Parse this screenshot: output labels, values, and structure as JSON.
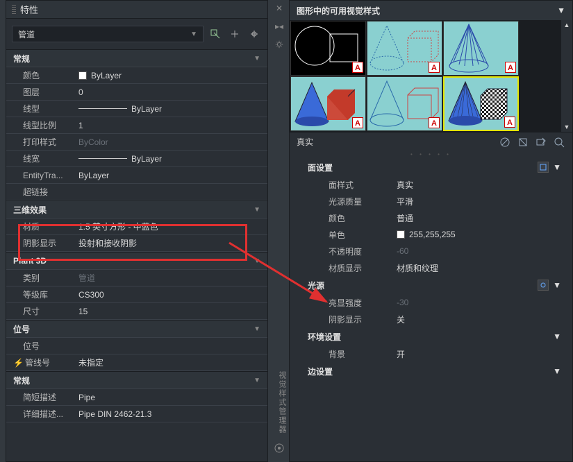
{
  "left": {
    "title": "特性",
    "selector": {
      "value": "管道"
    },
    "sections": {
      "general": {
        "title": "常规",
        "rows": {
          "color": {
            "label": "颜色",
            "value": "ByLayer"
          },
          "layer": {
            "label": "图层",
            "value": "0"
          },
          "linetype": {
            "label": "线型",
            "value": "ByLayer"
          },
          "ltscale": {
            "label": "线型比例",
            "value": "1"
          },
          "plotstyle": {
            "label": "打印样式",
            "value": "ByColor"
          },
          "lineweight": {
            "label": "线宽",
            "value": "ByLayer"
          },
          "transparency": {
            "label": "EntityTra...",
            "value": "ByLayer"
          },
          "hyperlink": {
            "label": "超链接",
            "value": ""
          }
        }
      },
      "threed": {
        "title": "三维效果",
        "rows": {
          "material": {
            "label": "材质",
            "value": "1.5 英寸方形 - 中蓝色"
          },
          "shadow": {
            "label": "阴影显示",
            "value": "投射和接收阴影"
          }
        }
      },
      "plant3d": {
        "title": "Plant 3D",
        "rows": {
          "category": {
            "label": "类别",
            "value": "管道"
          },
          "spec": {
            "label": "等级库",
            "value": "CS300"
          },
          "size": {
            "label": "尺寸",
            "value": "15"
          }
        }
      },
      "tag": {
        "title": "位号",
        "rows": {
          "tagno": {
            "label": "位号",
            "value": ""
          },
          "lineNo": {
            "label": "管线号",
            "value": "未指定"
          }
        }
      },
      "general2": {
        "title": "常规",
        "rows": {
          "sdesc": {
            "label": "简短描述",
            "value": "Pipe"
          },
          "ldesc": {
            "label": "详细描述...",
            "value": "Pipe DIN 2462-21.3"
          }
        }
      }
    }
  },
  "right": {
    "headerTitle": "图形中的可用视觉样式",
    "styleName": "真实",
    "face": {
      "title": "面设置",
      "rows": {
        "faceStyle": {
          "label": "面样式",
          "value": "真实"
        },
        "lightQ": {
          "label": "光源质量",
          "value": "平滑"
        },
        "color": {
          "label": "颜色",
          "value": "普通"
        },
        "mono": {
          "label": "单色",
          "value": "255,255,255"
        },
        "opacity": {
          "label": "不透明度",
          "value": "-60"
        },
        "matDisplay": {
          "label": "材质显示",
          "value": "材质和纹理"
        }
      }
    },
    "light": {
      "title": "光源",
      "rows": {
        "highlight": {
          "label": "亮显强度",
          "value": "-30"
        },
        "shadow": {
          "label": "阴影显示",
          "value": "关"
        }
      }
    },
    "env": {
      "title": "环境设置",
      "rows": {
        "bg": {
          "label": "背景",
          "value": "开"
        }
      }
    },
    "edge": {
      "title": "边设置"
    }
  },
  "sideText": "视觉样式管理器"
}
